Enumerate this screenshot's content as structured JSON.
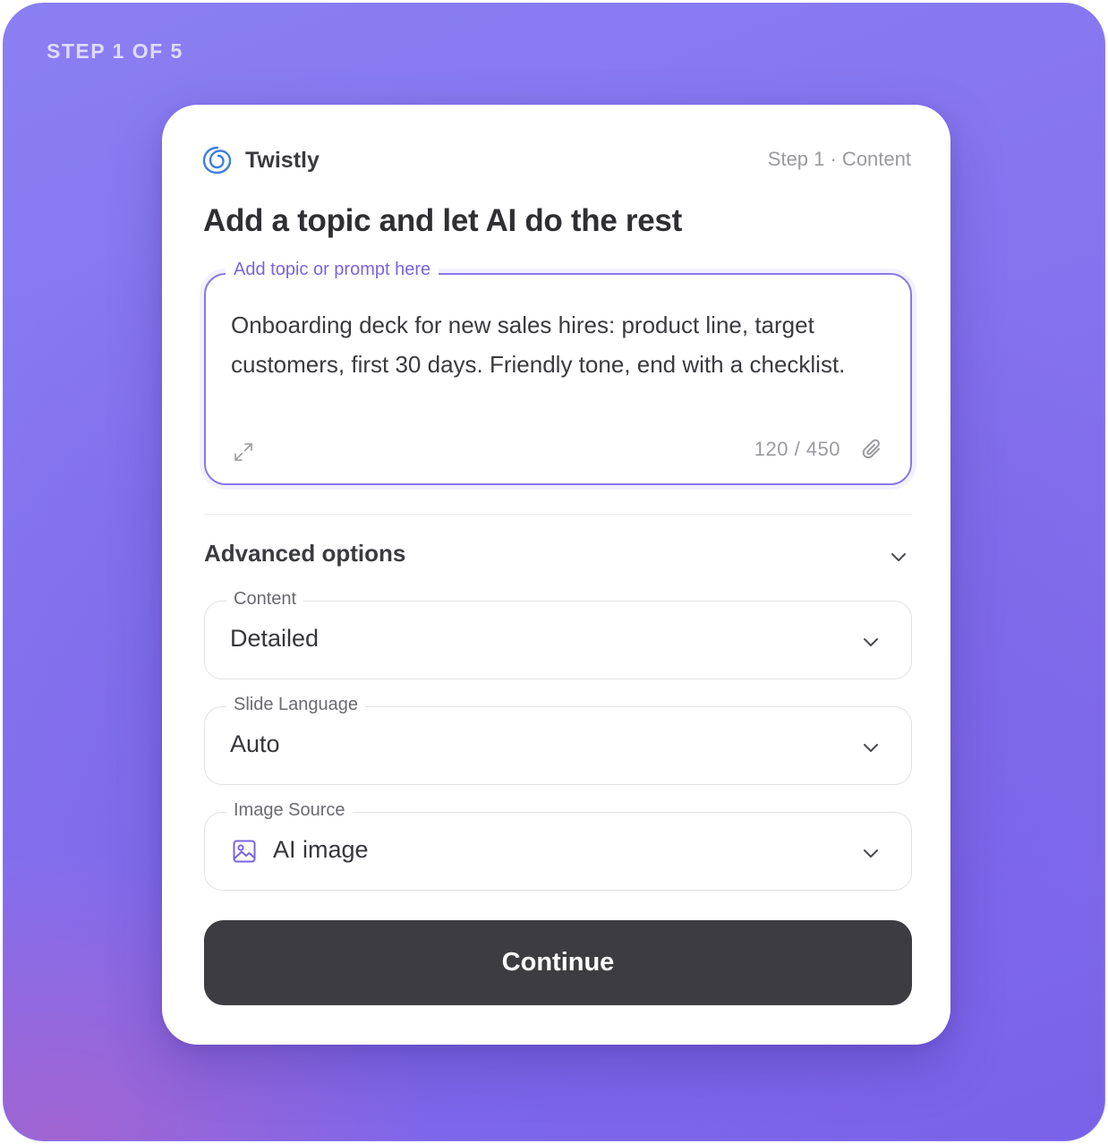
{
  "progress": {
    "label": "STEP 1 OF 5"
  },
  "brand": {
    "name": "Twistly",
    "icon": "swirl-logo-icon",
    "icon_color": "#3f7de0"
  },
  "header": {
    "step_label": "Step 1 · Content"
  },
  "headline": "Add a topic and let AI do the rest",
  "prompt": {
    "legend": "Add topic or prompt here",
    "value": "Onboarding deck for new sales hires: product line, target customers, first 30 days. Friendly tone, end with a checklist.",
    "char_count": "120 / 450",
    "expand_icon": "expand-icon",
    "attach_icon": "paperclip-icon"
  },
  "advanced": {
    "title": "Advanced options",
    "expanded": true,
    "fields": [
      {
        "label": "Content",
        "value": "Detailed"
      },
      {
        "label": "Slide Language",
        "value": "Auto"
      },
      {
        "label": "Image Source",
        "value": "AI image",
        "icon": "image-icon"
      }
    ]
  },
  "actions": {
    "continue_label": "Continue"
  },
  "colors": {
    "accent": "#7b63e0",
    "button_bg": "#3d3d41",
    "background": "#8572ee"
  }
}
